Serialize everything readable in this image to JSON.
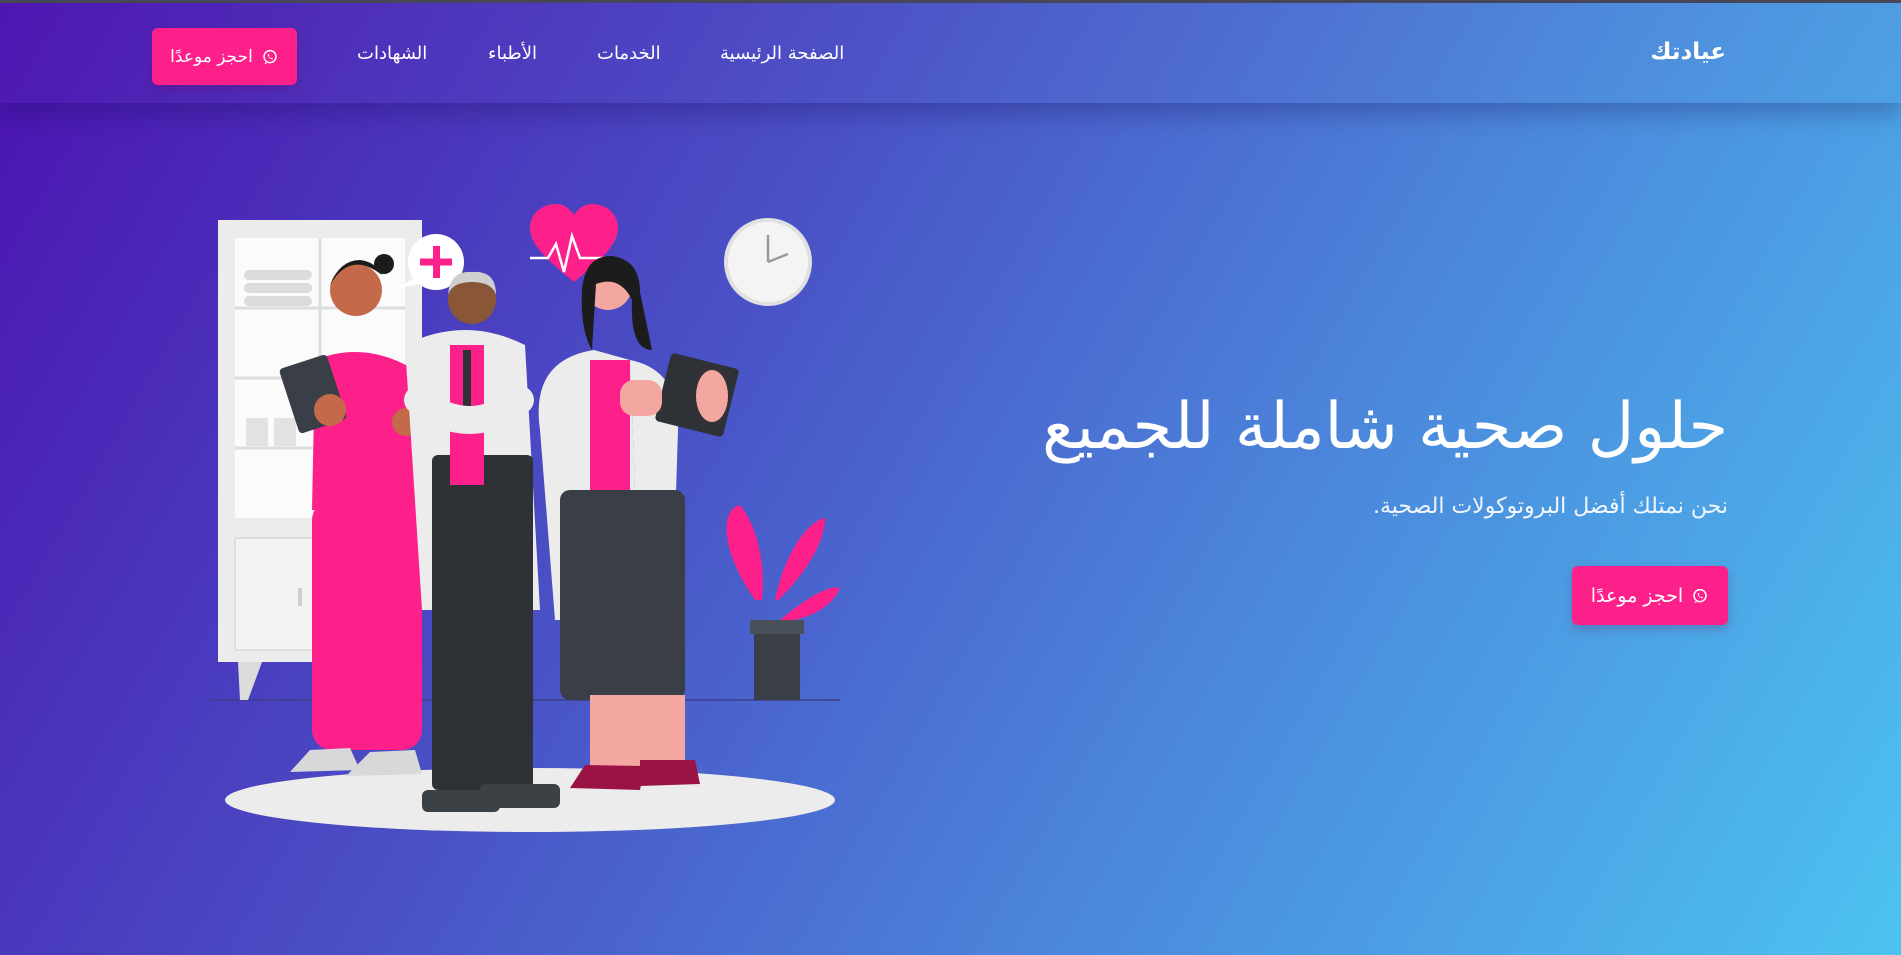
{
  "navbar": {
    "brand": "عيادتك",
    "links": [
      "الصفحة الرئيسية",
      "الخدمات",
      "الأطباء",
      "الشهادات"
    ],
    "cta_label": "احجز موعدًا"
  },
  "hero": {
    "title": "حلول صحية شاملة للجميع",
    "subtitle": "نحن نمتلك أفضل البروتوكولات الصحية.",
    "cta_label": "احجز موعدًا"
  },
  "colors": {
    "accent": "#fd1f8a",
    "gradient_start": "#4b12b0",
    "gradient_end": "#4cc3f0"
  },
  "icons": {
    "cta": "whatsapp-icon",
    "illustration": "doctors-team-illustration"
  }
}
